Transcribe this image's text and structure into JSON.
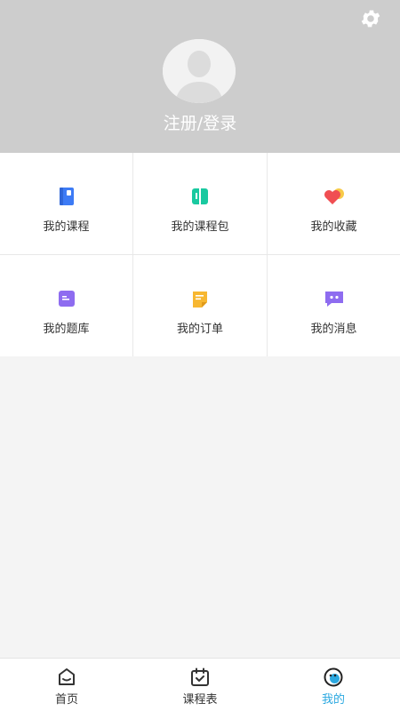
{
  "header": {
    "settings_icon": "gear-icon",
    "avatar_icon": "default-user-avatar",
    "login_label": "注册/登录"
  },
  "menu": {
    "items": [
      {
        "label": "我的课程",
        "icon": "course-book-icon",
        "color": "#3d7bf5"
      },
      {
        "label": "我的课程包",
        "icon": "course-package-icon",
        "color": "#19c9a0"
      },
      {
        "label": "我的收藏",
        "icon": "heart-favorite-icon",
        "color": "#f04e52"
      },
      {
        "label": "我的题库",
        "icon": "question-bank-icon",
        "color": "#8e6cf0"
      },
      {
        "label": "我的订单",
        "icon": "order-note-icon",
        "color": "#f7b731"
      },
      {
        "label": "我的消息",
        "icon": "message-chat-icon",
        "color": "#8e6cf0"
      }
    ]
  },
  "tabbar": {
    "tabs": [
      {
        "label": "首页",
        "icon": "home-icon",
        "active": false
      },
      {
        "label": "课程表",
        "icon": "calendar-check-icon",
        "active": false
      },
      {
        "label": "我的",
        "icon": "profile-face-icon",
        "active": true
      }
    ],
    "active_color": "#2aa8e0"
  },
  "colors": {
    "header_bg": "#cdcdcd",
    "page_bg": "#f4f4f4"
  }
}
